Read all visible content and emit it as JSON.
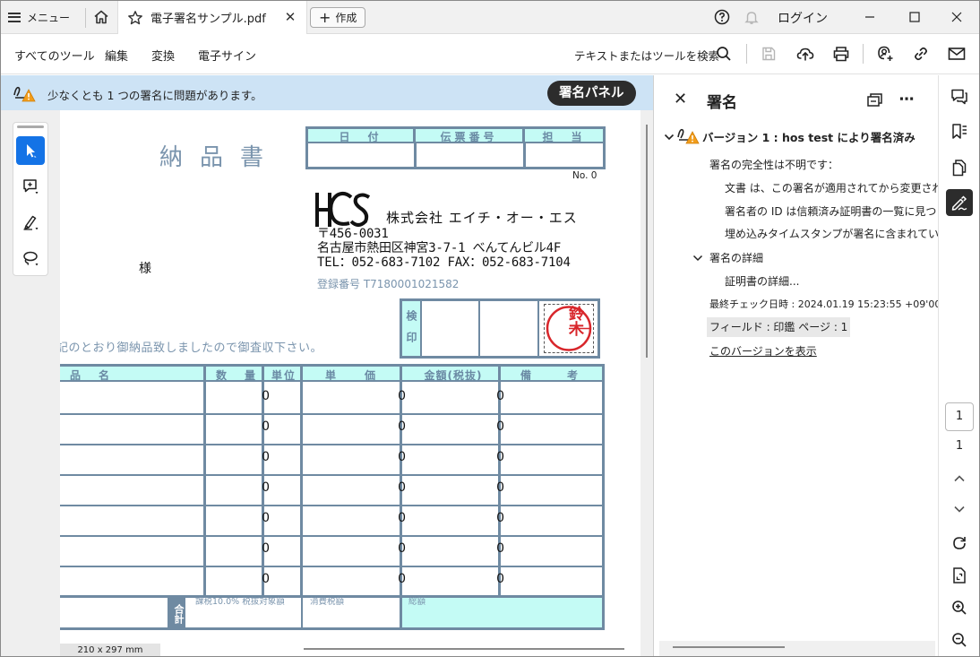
{
  "titlebar": {
    "menu_label": "メニュー",
    "tab_title": "電子署名サンプル.pdf",
    "create_label": "作成",
    "login_label": "ログイン"
  },
  "toolbar": {
    "tabs": [
      "すべてのツール",
      "編集",
      "変換",
      "電子サイン"
    ],
    "search_label": "テキストまたはツールを検索"
  },
  "banner": {
    "message": "少なくとも 1 つの署名に問題があります。",
    "button_label": "署名パネル"
  },
  "document": {
    "page_size": "210 x 297 mm",
    "title": "納品書",
    "header_cols": [
      "日　付",
      "伝票番号",
      "担　当"
    ],
    "no_label": "No. 0",
    "company": "株式会社 エイチ・オー・エス",
    "zip": "〒456-0031",
    "address": "名古屋市熱田区神宮3-7-1 べんてんビル4F",
    "tel_fax": "TEL：052-683-7102 FAX：052-683-7104",
    "registration": "登録番号 T7180001021582",
    "addressee_suffix": "様",
    "notice": "記のとおり御納品致しましたので御査収下さい。",
    "inspection_label": "検印",
    "seal_text": "鈴木",
    "item_cols": [
      "品　名",
      "数　量",
      "単位",
      "単　価",
      "金額(税抜)",
      "備　考"
    ],
    "rows": [
      {
        "qty": "0",
        "price": "0",
        "amount": "0"
      },
      {
        "qty": "0",
        "price": "0",
        "amount": "0"
      },
      {
        "qty": "0",
        "price": "0",
        "amount": "0"
      },
      {
        "qty": "0",
        "price": "0",
        "amount": "0"
      },
      {
        "qty": "0",
        "price": "0",
        "amount": "0"
      },
      {
        "qty": "0",
        "price": "0",
        "amount": "0"
      },
      {
        "qty": "0",
        "price": "0",
        "amount": "0"
      }
    ],
    "total_label": "合計",
    "taxable_label": "課税10.0% 税抜対象額",
    "tax_label": "消費税額",
    "grand_total_label": "総額"
  },
  "sig_panel": {
    "title": "署名",
    "version_title": "バージョン 1 : hos test により署名済み",
    "integrity": "署名の完全性は不明です：",
    "detail_1": "文書 は、この署名が適用されてから変更されて",
    "detail_2": "署名者の ID は信頼済み証明書の一覧に見つ",
    "detail_3": "埋め込みタイムスタンプが署名に含まれていま",
    "details_label": "署名の詳細",
    "cert_details": "証明書の詳細...",
    "last_checked": "最終チェック日時 : 2024.01.19 15:23:55 +09'00'",
    "field_info": "フィールド : 印鑑 ページ : 1",
    "view_version": "このバージョンを表示"
  },
  "right_rail": {
    "page_current": "1",
    "page_total": "1"
  },
  "colors": {
    "accent": "#1473e6",
    "banner_bg": "#cde3f5",
    "warning": "#f29d1b",
    "form_border": "#6f8aa2",
    "form_header_bg": "#c4fbf5",
    "seal_red": "#d8262b"
  }
}
